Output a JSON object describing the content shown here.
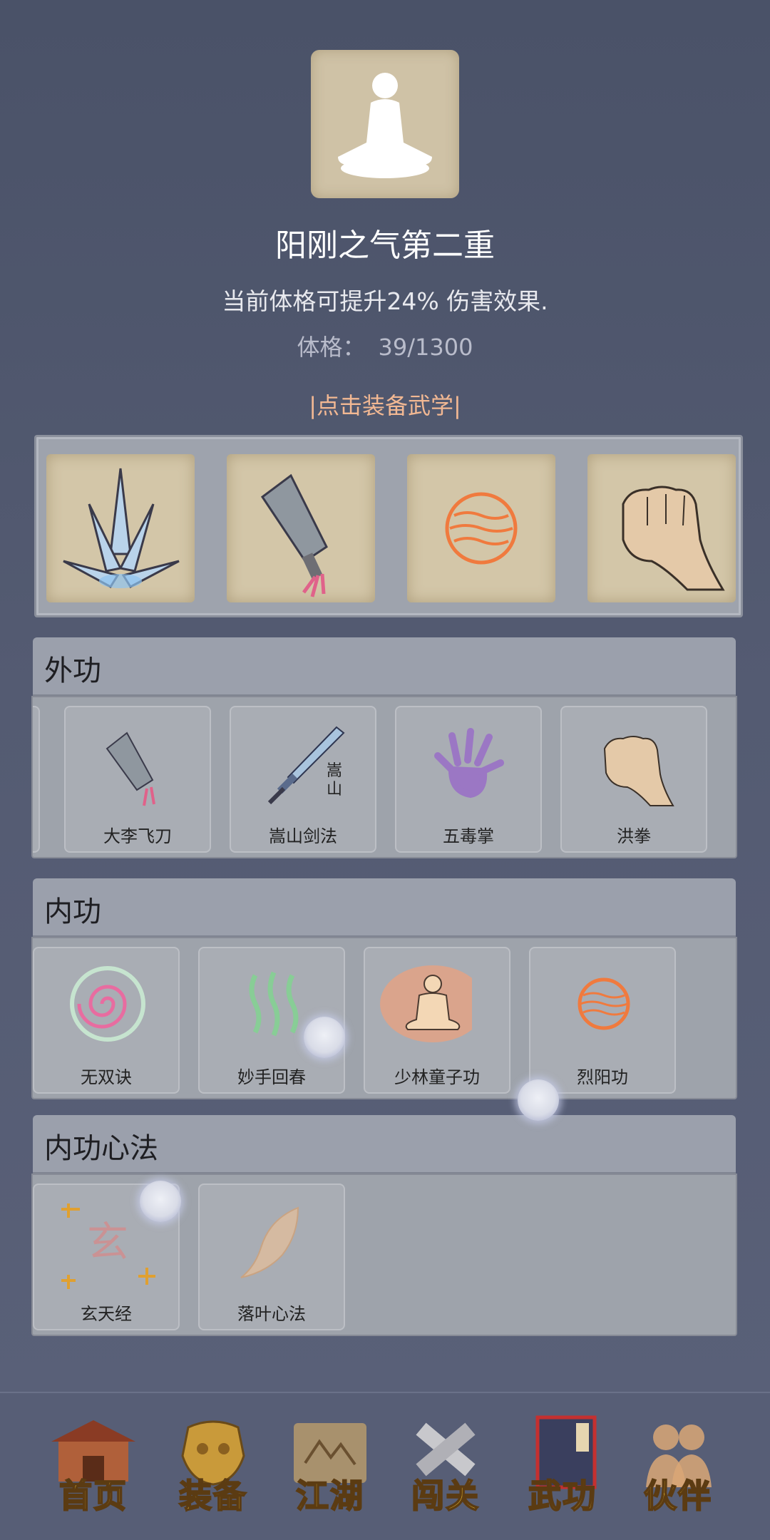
{
  "header": {
    "title": "阳刚之气第二重",
    "description": "当前体格可提升24% 伤害效果.",
    "stat_label": "体格：",
    "stat_value": "39/1300",
    "equip_link": "|点击装备武学|"
  },
  "equipped_slots": [
    {
      "icon": "ice-shards-icon"
    },
    {
      "icon": "cleaver-knife-icon"
    },
    {
      "icon": "fire-orb-icon"
    },
    {
      "icon": "fist-icon"
    }
  ],
  "sections": {
    "outer": {
      "title": "外功",
      "items": [
        {
          "label": "大李飞刀",
          "icon": "cleaver-knife-icon"
        },
        {
          "label": "嵩山剑法",
          "icon": "sword-icon",
          "icon_text": "嵩山"
        },
        {
          "label": "五毒掌",
          "icon": "purple-palm-icon"
        },
        {
          "label": "洪拳",
          "icon": "fist-icon"
        }
      ]
    },
    "inner": {
      "title": "内功",
      "items": [
        {
          "label": "无双诀",
          "icon": "spiral-icon"
        },
        {
          "label": "妙手回春",
          "icon": "green-waves-icon"
        },
        {
          "label": "少林童子功",
          "icon": "meditating-monk-icon"
        },
        {
          "label": "烈阳功",
          "icon": "fire-orb-icon"
        }
      ]
    },
    "mind": {
      "title": "内功心法",
      "items": [
        {
          "label": "玄天经",
          "icon": "xuan-glyph-icon",
          "icon_text": "玄"
        },
        {
          "label": "落叶心法",
          "icon": "leaf-icon"
        }
      ]
    }
  },
  "nav": [
    {
      "label": "首页",
      "icon": "temple-icon"
    },
    {
      "label": "装备",
      "icon": "armor-icon"
    },
    {
      "label": "江湖",
      "icon": "scroll-map-icon"
    },
    {
      "label": "闯关",
      "icon": "crossed-swords-icon"
    },
    {
      "label": "武功",
      "icon": "martial-book-icon"
    },
    {
      "label": "伙伴",
      "icon": "companions-icon"
    }
  ],
  "colors": {
    "background": "#4f566d",
    "link": "#f2b893",
    "nav_label": "#f3c12f",
    "panel": "#9ea3ab"
  }
}
